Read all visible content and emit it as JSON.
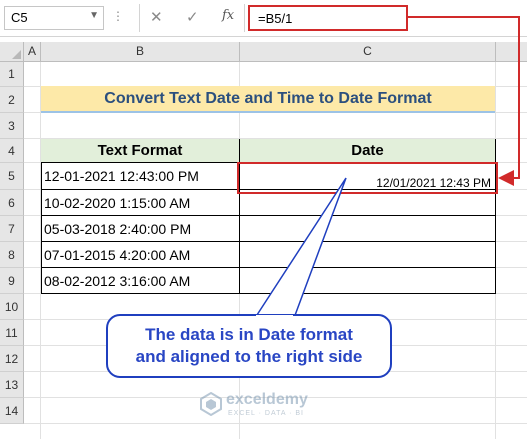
{
  "formula_bar": {
    "name_box": "C5",
    "formula": "=B5/1",
    "fx_label": "fx",
    "cancel_icon": "close-icon",
    "enter_icon": "check-icon"
  },
  "columns": [
    "A",
    "B",
    "C"
  ],
  "rows": [
    "1",
    "2",
    "3",
    "4",
    "5",
    "6",
    "7",
    "8",
    "9",
    "10",
    "11",
    "12",
    "13",
    "14"
  ],
  "title": "Convert Text Date and Time to Date Format",
  "table": {
    "headers": [
      "Text Format",
      "Date"
    ],
    "rows": [
      [
        "12-01-2021  12:43:00 PM",
        "12/01/2021 12:43 PM"
      ],
      [
        "10-02-2020  1:15:00 AM",
        ""
      ],
      [
        "05-03-2018  2:40:00 PM",
        ""
      ],
      [
        "07-01-2015  4:20:00 AM",
        ""
      ],
      [
        "08-02-2012  3:16:00 AM",
        ""
      ]
    ]
  },
  "callout": {
    "line1": "The data is in Date format",
    "line2": "and aligned to the right side"
  },
  "watermark": {
    "name": "exceldemy",
    "tagline": "EXCEL · DATA · BI"
  },
  "colors": {
    "highlight_red": "#d12a2a",
    "title_fill": "#fde9a8",
    "header_fill": "#e2efda",
    "callout_blue": "#2946c4"
  }
}
